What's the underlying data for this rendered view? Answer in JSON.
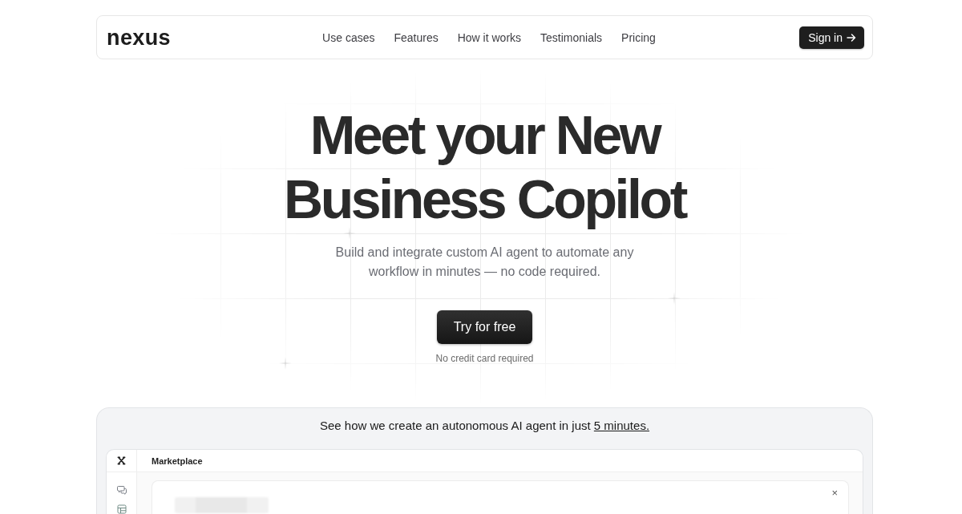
{
  "navbar": {
    "logo": "nexus",
    "links": [
      {
        "label": "Use cases"
      },
      {
        "label": "Features"
      },
      {
        "label": "How it works"
      },
      {
        "label": "Testimonials"
      },
      {
        "label": "Pricing"
      }
    ],
    "sign_in": {
      "label": "Sign in"
    }
  },
  "hero": {
    "title": "Meet your New Business Copilot",
    "subtitle": "Build and integrate custom AI agent to automate any workflow in minutes — no code required.",
    "cta": {
      "label": "Try for free"
    },
    "note": "No credit card required"
  },
  "demo": {
    "caption": "See how we create an autonomous AI agent in just",
    "caption_link": "5 minutes.",
    "app": {
      "page_title": "Marketplace",
      "sidebar_items": [
        {
          "kind": "chat"
        },
        {
          "kind": "layout"
        }
      ],
      "dialog": {
        "close": "×"
      }
    }
  }
}
